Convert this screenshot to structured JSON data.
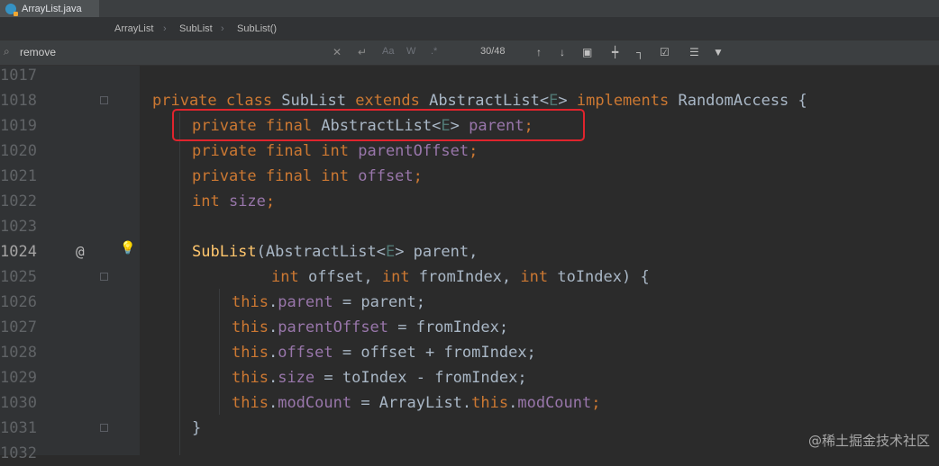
{
  "tab": {
    "label": "ArrayList.java",
    "icon": "java-class-icon"
  },
  "breadcrumb": [
    "ArrayList",
    "SubList",
    "SubList()"
  ],
  "find": {
    "value": "remove",
    "match_count": "30/48",
    "opts": {
      "case": "Aa",
      "word": "W",
      "regex": ".*"
    }
  },
  "lines": [
    {
      "n": "1017"
    },
    {
      "n": "1018"
    },
    {
      "n": "1019"
    },
    {
      "n": "1020"
    },
    {
      "n": "1021"
    },
    {
      "n": "1022"
    },
    {
      "n": "1023"
    },
    {
      "n": "1024"
    },
    {
      "n": "1025"
    },
    {
      "n": "1026"
    },
    {
      "n": "1027"
    },
    {
      "n": "1028"
    },
    {
      "n": "1029"
    },
    {
      "n": "1030"
    },
    {
      "n": "1031"
    },
    {
      "n": "1032"
    }
  ],
  "code": {
    "l1018": {
      "kw1": "private class ",
      "name": "SubList",
      "kw2": " extends ",
      "t1": "AbstractList<",
      "g": "E",
      "t2": "> ",
      "kw3": "implements ",
      "t3": "RandomAccess {"
    },
    "l1019": {
      "kw": "private final ",
      "t1": "AbstractList<",
      "g": "E",
      "t2": "> ",
      "f": "parent",
      "t3": ";"
    },
    "l1020": {
      "kw": "private final int ",
      "f": "parentOffset",
      "t": ";"
    },
    "l1021": {
      "kw": "private final int ",
      "f": "offset",
      "t": ";"
    },
    "l1022": {
      "kw": "int ",
      "f": "size",
      "t": ";"
    },
    "l1024": {
      "name": "SubList",
      "t1": "(AbstractList<",
      "g": "E",
      "t2": "> parent,"
    },
    "l1025": {
      "kw1": "int ",
      "t1": "offset, ",
      "kw2": "int ",
      "t2": "fromIndex, ",
      "kw3": "int ",
      "t3": "toIndex) {"
    },
    "l1026": {
      "kw": "this",
      "d": ".",
      "f": "parent",
      "t": " = parent;"
    },
    "l1027": {
      "kw": "this",
      "d": ".",
      "f": "parentOffset",
      "t": " = fromIndex;"
    },
    "l1028": {
      "kw": "this",
      "d": ".",
      "f": "offset",
      "t": " = offset + fromIndex;"
    },
    "l1029": {
      "kw": "this",
      "d": ".",
      "f": "size",
      "t": " = toIndex - fromIndex;"
    },
    "l1030": {
      "kw": "this",
      "d": ".",
      "f": "modCount",
      "t1": " = ArrayList.",
      "kw2": "this",
      "d2": ".",
      "f2": "modCount",
      "t2": ";"
    },
    "l1031": {
      "t": "}"
    }
  },
  "gutter_marks": {
    "override": "@"
  },
  "watermark": "@稀土掘金技术社区",
  "colors": {
    "keyword": "#cc7832",
    "field": "#9876aa",
    "method": "#ffc66d",
    "generic": "#507874",
    "highlight_box": "#e0242d"
  }
}
